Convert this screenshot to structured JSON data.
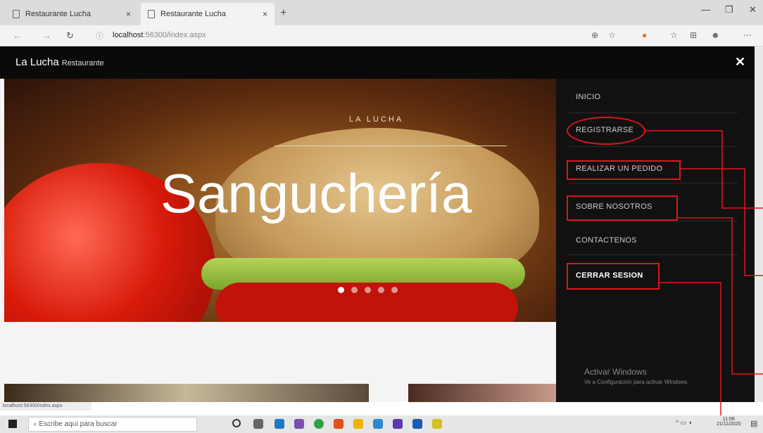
{
  "browser": {
    "tabs": [
      {
        "label": "Restaurante Lucha"
      },
      {
        "label": "Restaurante Lucha"
      }
    ],
    "new_tab": "+",
    "address": {
      "host": "localhost",
      "rest": ":56300/index.aspx"
    }
  },
  "site": {
    "brand": "La Lucha",
    "brand_sub": "Restaurante",
    "hero_label": "LA LUCHA",
    "hero_title": "Sanguchería"
  },
  "menu": {
    "items": [
      {
        "label": "INICIO"
      },
      {
        "label": "REGISTRARSE"
      },
      {
        "label": "REALIZAR UN PEDIDO"
      },
      {
        "label": "SOBRE NOSOTROS"
      },
      {
        "label": "CONTACTENOS"
      },
      {
        "label": "CERRAR SESION"
      }
    ]
  },
  "windows": {
    "activate_title": "Activar Windows",
    "activate_sub": "Ve a Configuración para activar Windows.",
    "status_url": "localhost:56300/index.aspx",
    "search_placeholder": "Escribe aquí para buscar",
    "clock_time": "11:08",
    "clock_date": "21/11/2020"
  },
  "icons": {
    "back": "back-arrow-icon",
    "forward": "forward-arrow-icon",
    "reload": "reload-icon",
    "close": "close-icon"
  },
  "colors": {
    "annotation": "#e0151b",
    "menu_bg": "#111111",
    "nav_bg": "#0a0a0a"
  }
}
